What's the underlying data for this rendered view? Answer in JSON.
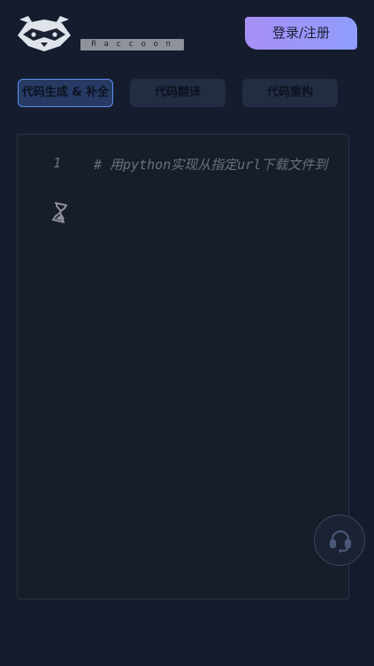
{
  "brand": {
    "logo_icon": "raccoon-logo-icon",
    "name": "Raccoon"
  },
  "header": {
    "login_label": "登录/注册"
  },
  "tabs": [
    {
      "label": "代码生成 & 补全",
      "active": true
    },
    {
      "label": "代码翻译",
      "active": false
    },
    {
      "label": "代码重构",
      "active": false
    }
  ],
  "editor": {
    "line_number": "1",
    "code": "# 用python实现从指定url下载文件到",
    "loading_icon": "hourglass-icon"
  },
  "support": {
    "icon": "headset-icon"
  },
  "colors": {
    "background": "#141c2e",
    "accent_gradient_start": "#a88ff6",
    "accent_gradient_end": "#8f9dfb",
    "active_tab_border": "#5f8ff2"
  }
}
